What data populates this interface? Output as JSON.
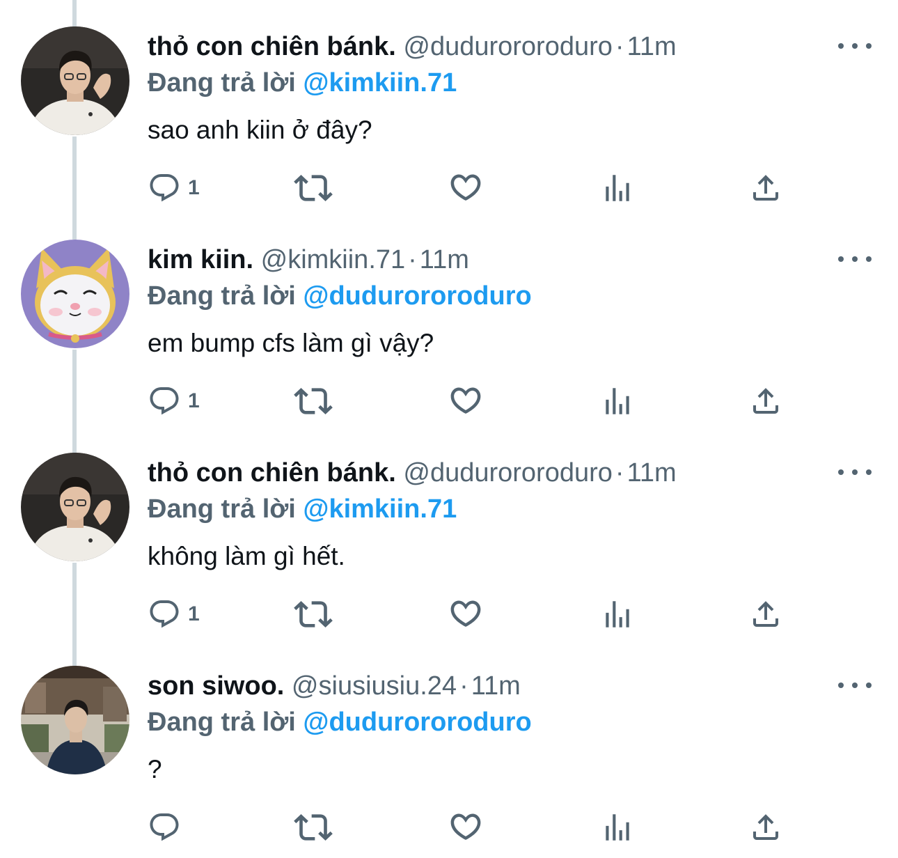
{
  "feed": {
    "tweets": [
      {
        "display_name": "thỏ con chiên bánk.",
        "handle": "@dudurororoduro",
        "separator": "·",
        "time": "11m",
        "reply_prefix": "Đang trả lời",
        "reply_to": "@kimkiin.71",
        "text": "sao anh kiin ở đây?",
        "reply_count": "1",
        "avatar_icon": "avatar-man-white-shirt"
      },
      {
        "display_name": "kim kiin.",
        "handle": "@kimkiin.71",
        "separator": "·",
        "time": "11m",
        "reply_prefix": "Đang trả lời",
        "reply_to": "@dudurororoduro",
        "text": "em bump cfs làm gì vậy?",
        "reply_count": "1",
        "avatar_icon": "avatar-cartoon-cat"
      },
      {
        "display_name": "thỏ con chiên bánk.",
        "handle": "@dudurororoduro",
        "separator": "·",
        "time": "11m",
        "reply_prefix": "Đang trả lời",
        "reply_to": "@kimkiin.71",
        "text": "không làm gì hết.",
        "reply_count": "1",
        "avatar_icon": "avatar-man-white-shirt"
      },
      {
        "display_name": "son siwoo.",
        "handle": "@siusiusiu.24",
        "separator": "·",
        "time": "11m",
        "reply_prefix": "Đang trả lời",
        "reply_to": "@dudurororoduro",
        "text": "?",
        "reply_count": "",
        "avatar_icon": "avatar-man-street"
      }
    ]
  },
  "colors": {
    "text_primary": "#0f1419",
    "text_secondary": "#536471",
    "mention_blue": "#1d9bf0",
    "thread_line": "#cfd9de"
  },
  "icons": {
    "reply": "reply-icon",
    "retweet": "retweet-icon",
    "like": "heart-icon",
    "views": "views-icon",
    "share": "share-icon",
    "more": "more-icon"
  }
}
